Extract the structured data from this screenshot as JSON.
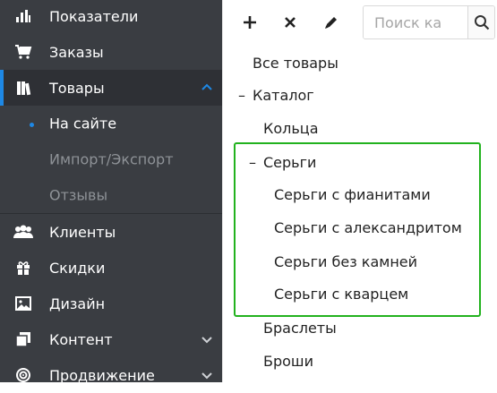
{
  "sidebar": {
    "items": [
      {
        "label": "Показатели",
        "icon": "bar-chart-icon"
      },
      {
        "label": "Заказы",
        "icon": "cart-icon"
      },
      {
        "label": "Товары",
        "icon": "books-icon"
      },
      {
        "label": "Клиенты",
        "icon": "users-icon"
      },
      {
        "label": "Скидки",
        "icon": "gift-icon"
      },
      {
        "label": "Дизайн",
        "icon": "image-icon"
      },
      {
        "label": "Контент",
        "icon": "copy-icon"
      },
      {
        "label": "Продвижение",
        "icon": "target-icon"
      }
    ],
    "submenu": [
      {
        "label": "На сайте"
      },
      {
        "label": "Импорт/Экспорт"
      },
      {
        "label": "Отзывы"
      }
    ]
  },
  "toolbar": {
    "add_icon": "plus-icon",
    "delete_icon": "close-icon",
    "edit_icon": "pencil-icon",
    "search_placeholder": "Поиск ка",
    "search_icon": "search-icon"
  },
  "tree": {
    "all": "Все товары",
    "catalog": {
      "toggle": "–",
      "label": "Каталог"
    },
    "rings": "Кольца",
    "earrings": {
      "toggle": "–",
      "label": "Серьги"
    },
    "earrings_children": [
      "Серьги с фианитами",
      "Серьги с александритом",
      "Серьги без камней",
      "Серьги с кварцем"
    ],
    "bracelets": "Браслеты",
    "brooches": "Броши"
  },
  "colors": {
    "sidebar_bg": "#3a3d42",
    "accent": "#1e88e5",
    "highlight": "#22b21e"
  }
}
